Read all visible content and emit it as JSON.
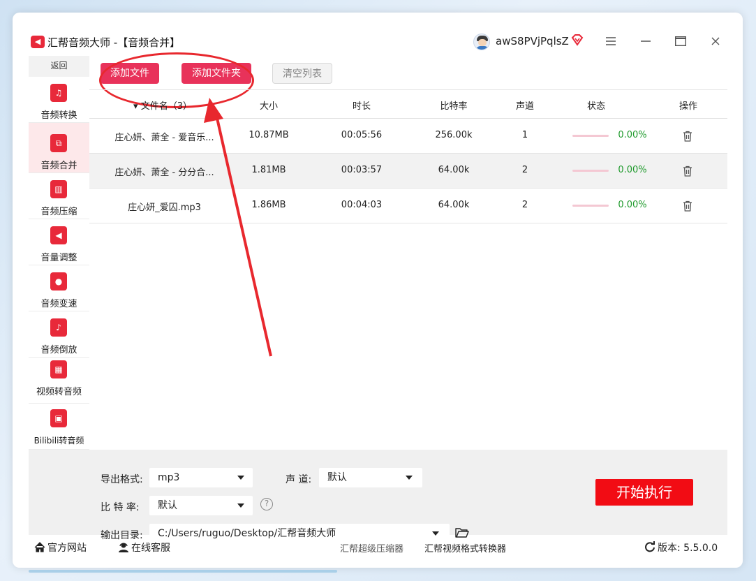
{
  "window": {
    "app_title": "汇帮音频大师 -【音频合并】",
    "username": "awS8PVjPqlsZ",
    "menu_icon": "menu-icon",
    "min_icon": "minimize-icon",
    "max_icon": "maximize-icon",
    "close_icon": "close-icon"
  },
  "sidebar": {
    "back_label": "返回",
    "items": [
      {
        "label": "音频转换",
        "icon": "audio-convert-icon",
        "glyph": "♫"
      },
      {
        "label": "音频合并",
        "icon": "audio-merge-icon",
        "glyph": "⧉",
        "active": true
      },
      {
        "label": "音频压缩",
        "icon": "audio-compress-icon",
        "glyph": "▥"
      },
      {
        "label": "音量调整",
        "icon": "volume-adjust-icon",
        "glyph": "◀"
      },
      {
        "label": "音频变速",
        "icon": "microphone-icon",
        "glyph": "●"
      },
      {
        "label": "音频倒放",
        "icon": "music-note-icon",
        "glyph": "♪"
      },
      {
        "label": "视频转音频",
        "icon": "film-icon",
        "glyph": "▦"
      },
      {
        "label": "Bilibili转音频",
        "icon": "tv-icon",
        "glyph": "▣"
      }
    ]
  },
  "toolbar": {
    "add_file": "添加文件",
    "add_folder": "添加文件夹",
    "clear_list": "清空列表"
  },
  "table": {
    "columns": {
      "name": "▾ 文件名（3）",
      "size": "大小",
      "duration": "时长",
      "bitrate": "比特率",
      "channels": "声道",
      "status": "状态",
      "action": "操作"
    },
    "rows": [
      {
        "name": "庄心妍、萧全 - 爱音乐...",
        "size": "10.87MB",
        "duration": "00:05:56",
        "bitrate": "256.00k",
        "channels": "1",
        "progress": 0.0,
        "status": "0.00%"
      },
      {
        "name": "庄心妍、萧全 - 分分合...",
        "size": "1.81MB",
        "duration": "00:03:57",
        "bitrate": "64.00k",
        "channels": "2",
        "progress": 0.0,
        "status": "0.00%"
      },
      {
        "name": "庄心妍_爱囚.mp3",
        "size": "1.86MB",
        "duration": "00:04:03",
        "bitrate": "64.00k",
        "channels": "2",
        "progress": 0.0,
        "status": "0.00%"
      }
    ]
  },
  "settings": {
    "format_label": "导出格式:",
    "format_value": "mp3",
    "channel_label": "声 道:",
    "channel_value": "默认",
    "bitrate_label": "比 特 率:",
    "bitrate_value": "默认",
    "help": "?",
    "output_label": "输出目录:",
    "output_value": "C:/Users/ruguo/Desktop/汇帮音频大师",
    "start_button": "开始执行"
  },
  "footer": {
    "website": "官方网站",
    "support": "在线客服",
    "link1": "汇帮超级压缩器",
    "link2": "汇帮视频格式转换器",
    "version": "版本:  5.5.0.0"
  },
  "colors": {
    "accent": "#e8325a",
    "brand_red": "#e8293a",
    "start_red": "#f20c14",
    "status_green": "#1f9a2c",
    "annotation_red": "#e8282e"
  }
}
